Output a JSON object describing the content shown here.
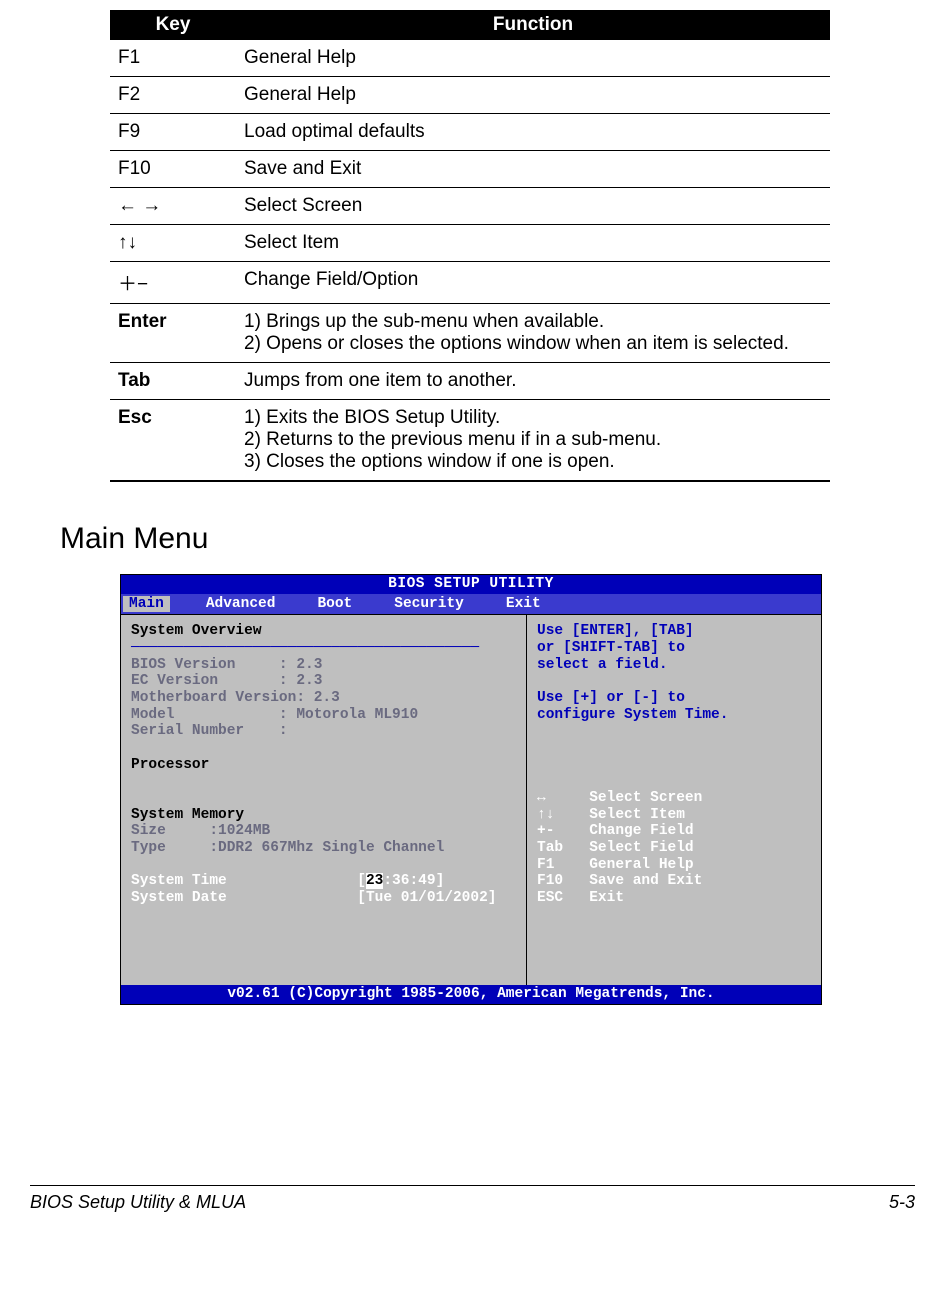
{
  "table": {
    "headers": {
      "key": "Key",
      "function": "Function"
    },
    "rows": [
      {
        "key": "F1",
        "function": "General Help",
        "bold": false
      },
      {
        "key": "F2",
        "function": "General Help",
        "bold": false
      },
      {
        "key": "F9",
        "function": "Load optimal defaults",
        "bold": false
      },
      {
        "key": "F10",
        "function": "Save and Exit",
        "bold": false
      },
      {
        "key": "←  →",
        "function": "Select Screen",
        "bold": false
      },
      {
        "key": "↑↓",
        "function": "Select Item",
        "bold": false
      },
      {
        "key": "＋−",
        "function": "Change Field/Option",
        "bold": false
      },
      {
        "key": "Enter",
        "function": "1) Brings up the sub-menu when available.\n2) Opens or closes the options window when an item is selected.",
        "bold": true
      },
      {
        "key": "Tab",
        "function": "Jumps from one item to another.",
        "bold": true
      },
      {
        "key": "Esc",
        "function": "1) Exits the BIOS Setup Utility.\n2) Returns to the previous menu if in a sub-menu.\n3) Closes the options window if one is open.",
        "bold": true
      }
    ]
  },
  "section_heading": "Main Menu",
  "bios": {
    "title": "BIOS SETUP UTILITY",
    "tabs": [
      "Main",
      "Advanced",
      "Boot",
      "Security",
      "Exit"
    ],
    "active_tab": 0,
    "left": {
      "header": "System Overview",
      "divider": "────────────────────────────────────────",
      "bios_version_label": "BIOS Version",
      "bios_version": "2.3",
      "ec_version_label": "EC Version",
      "ec_version": "2.3",
      "mb_version_label": "Motherboard Version:",
      "mb_version": "2.3",
      "model_label": "Model",
      "model_value": "Motorola ML910",
      "serial_label": "Serial Number",
      "serial_value": "",
      "processor_label": "Processor",
      "memory_header": "System Memory",
      "size_label": "Size",
      "size_value": "1024MB",
      "type_label": "Type",
      "type_value": "DDR2 667Mhz Single Channel",
      "time_label": "System Time",
      "time_value_hh": "23",
      "time_value_rest": ":36:49]",
      "date_label": "System Date",
      "date_value": "[Tue 01/01/2002]"
    },
    "right": {
      "help1": "Use [ENTER], [TAB]",
      "help2": "or [SHIFT-TAB] to",
      "help3": "select a field.",
      "help4": "Use [+] or [-] to",
      "help5": "configure System Time.",
      "nav": [
        {
          "k": "↔",
          "v": "Select Screen"
        },
        {
          "k": "↑↓",
          "v": "Select Item"
        },
        {
          "k": "+-",
          "v": "Change Field"
        },
        {
          "k": "Tab",
          "v": "Select Field"
        },
        {
          "k": "F1",
          "v": "General Help"
        },
        {
          "k": "F10",
          "v": "Save and Exit"
        },
        {
          "k": "ESC",
          "v": "Exit"
        }
      ]
    },
    "footer": "v02.61 (C)Copyright 1985-2006, American Megatrends, Inc."
  },
  "page_footer": {
    "left": "BIOS Setup Utility & MLUA",
    "right": "5-3"
  }
}
